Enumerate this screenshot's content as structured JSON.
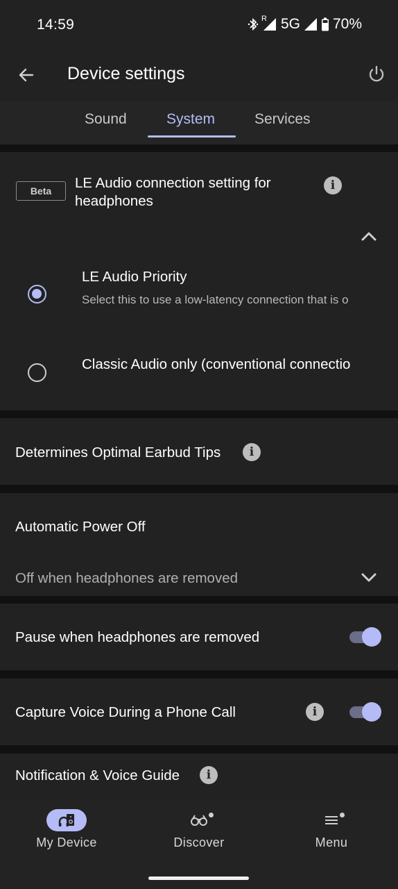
{
  "status_bar": {
    "time": "14:59",
    "network": "5G",
    "roaming_indicator": "R",
    "battery": "70%",
    "icons": [
      "bluetooth-icon",
      "signal-roaming-icon",
      "signal-icon",
      "battery-icon"
    ]
  },
  "app_bar": {
    "title": "Device settings",
    "back_icon": "arrow-left-icon",
    "power_icon": "power-icon"
  },
  "tabs": [
    {
      "label": "Sound",
      "active": false
    },
    {
      "label": "System",
      "active": true
    },
    {
      "label": "Services",
      "active": false
    }
  ],
  "le_audio": {
    "badge": "Beta",
    "title": "LE Audio connection setting for headphones",
    "expanded": true,
    "options": [
      {
        "title": "LE Audio Priority",
        "subtitle": "Select this to use a low-latency connection that is o",
        "selected": true
      },
      {
        "title": "Classic Audio only (conventional connectio",
        "subtitle": "",
        "selected": false
      }
    ]
  },
  "earbud_tips": {
    "label": "Determines Optimal Earbud Tips"
  },
  "auto_power_off": {
    "label": "Automatic Power Off",
    "value": "Off when headphones are removed"
  },
  "pause_removed": {
    "label": "Pause when headphones are removed",
    "enabled": true
  },
  "capture_voice": {
    "label": "Capture Voice During a Phone Call",
    "enabled": true
  },
  "notification_voice": {
    "label": "Notification & Voice Guide"
  },
  "bottom_nav": [
    {
      "label": "My Device",
      "icon": "headphones-speaker-icon",
      "active": true,
      "badge": false
    },
    {
      "label": "Discover",
      "icon": "binoculars-icon",
      "active": false,
      "badge": true
    },
    {
      "label": "Menu",
      "icon": "menu-icon",
      "active": false,
      "badge": true
    }
  ],
  "colors": {
    "accent": "#b4bbf6",
    "background": "#222222",
    "divider": "#111111"
  }
}
